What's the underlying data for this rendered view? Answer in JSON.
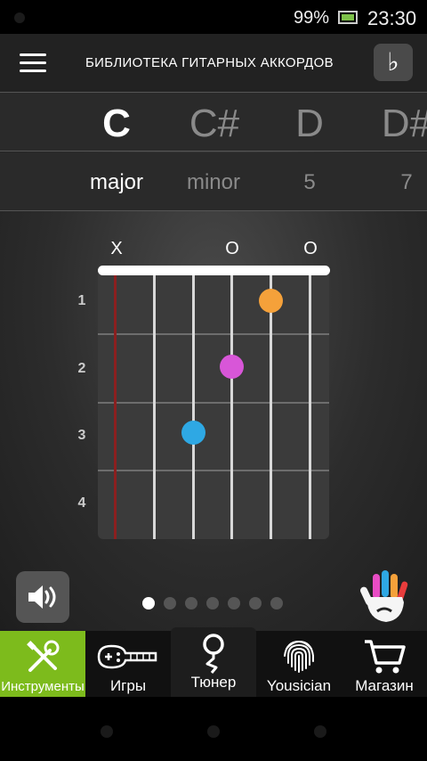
{
  "status": {
    "battery": "99%",
    "time": "23:30"
  },
  "header": {
    "title": "БИБЛИОТЕКА ГИТАРНЫХ АККОРДОВ",
    "flat_symbol": "♭"
  },
  "roots": [
    "C",
    "C#",
    "D",
    "D#"
  ],
  "chord_types": [
    "major",
    "minor",
    "5",
    "7"
  ],
  "selected_root": "C",
  "selected_type": "major",
  "string_marks": [
    "X",
    "",
    "",
    "O",
    "",
    "O"
  ],
  "fret_numbers": [
    "1",
    "2",
    "3",
    "4"
  ],
  "fingers": [
    {
      "string": 5,
      "fret": 1,
      "color": "#f5a13a"
    },
    {
      "string": 4,
      "fret": 2,
      "color": "#d856d8"
    },
    {
      "string": 3,
      "fret": 3,
      "color": "#2ea8e4"
    }
  ],
  "pager": {
    "count": 7,
    "active": 0
  },
  "tabs": [
    {
      "label": "Инструменты",
      "icon": "tools-icon"
    },
    {
      "label": "Игры",
      "icon": "guitar-gamepad-icon"
    },
    {
      "label": "Тюнер",
      "icon": "tuner-icon"
    },
    {
      "label": "Yousician",
      "icon": "fingerprint-icon"
    },
    {
      "label": "Магазин",
      "icon": "cart-icon"
    }
  ],
  "colors": {
    "accent": "#7dbb1c",
    "muted_string": "#8b1f1f"
  }
}
